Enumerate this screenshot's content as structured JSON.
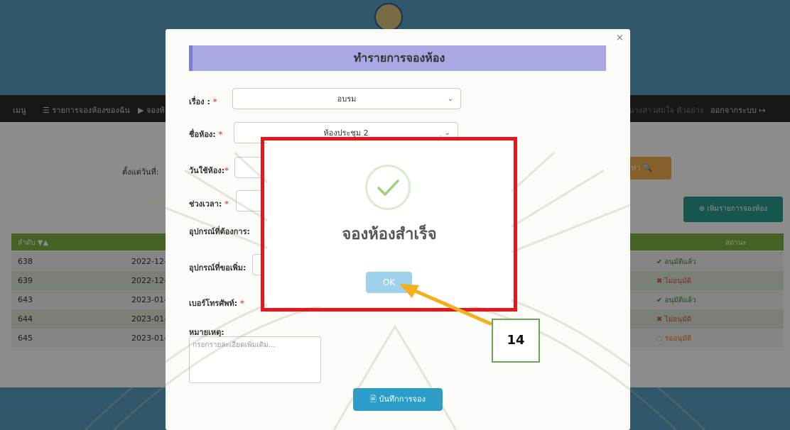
{
  "nav": {
    "menu": "เมนู",
    "my_bookings": "☰ รายการจองห้องของฉัน",
    "book": "▶ จองห้",
    "user": "นางสาวสมใจ ตัวอย่าง",
    "logout": "ออกจากระบบ ↦"
  },
  "filter": {
    "from_label": "ตั้งแต่วันที่:",
    "search_label": "หา 🔍"
  },
  "add_button": "⊕ เพิ่มรายการจองห้อง",
  "table": {
    "headers": {
      "order": "ลำดับ ▼▲",
      "status": "สถานะ"
    },
    "rows": [
      {
        "id": "638",
        "date": "2022-12-",
        "status": "✔ อนุมัติแล้ว",
        "status_color": "#3c8d2f"
      },
      {
        "id": "639",
        "date": "2022-12-",
        "status": "✖ ไม่อนุมัติ",
        "status_color": "#d9534f"
      },
      {
        "id": "643",
        "date": "2023-01-",
        "status": "✔ อนุมัติแล้ว",
        "status_color": "#3c8d2f"
      },
      {
        "id": "644",
        "date": "2023-01-",
        "status": "✖ ไม่อนุมัติ",
        "status_color": "#d9534f"
      },
      {
        "id": "645",
        "date": "2023-01-",
        "status": "◌ รออนุมัติ",
        "status_color": "#e67e22"
      }
    ]
  },
  "modal": {
    "title": "ทำรายการจองห้อง",
    "close": "×",
    "topic_label": "เรื่อง :",
    "topic_value": "อบรม",
    "room_label": "ชื่อห้อง:",
    "room_value": "ห้องประชุม 2",
    "date_label": "วันใช้ห้อง:",
    "time_label": "ช่วงเวลา:",
    "equipment_label": "อุปกรณ์ที่ต้องการ:",
    "extra_equipment_label": "อุปกรณ์ที่ขอเพิ่ม:",
    "phone_label": "เบอร์โทรศัพท์:",
    "notes_label": "หมายเหตุ:",
    "notes_placeholder": "กรอกรายละเอียดเพิ่มเติม...",
    "save_button": "🖹 บันทึกการจอง",
    "required_mark": "*"
  },
  "alert": {
    "icon": "check-icon",
    "message": "จองห้องสำเร็จ",
    "ok_button": "OK"
  },
  "callout": {
    "number": "14"
  },
  "colors": {
    "header": "#5a9fc2",
    "nav": "#2b2b2b",
    "table_header": "#7cb342",
    "alert_border": "#e8151e",
    "arrow": "#f2b01e"
  }
}
